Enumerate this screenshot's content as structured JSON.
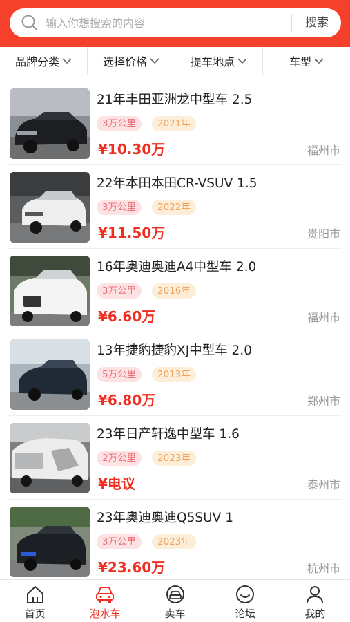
{
  "search": {
    "placeholder": "输入你想搜索的内容",
    "button": "搜索"
  },
  "filters": [
    "品牌分类",
    "选择价格",
    "提车地点",
    "车型"
  ],
  "cars": [
    {
      "title": "21年丰田亚洲龙中型车 2.5",
      "mileage": "3万公里",
      "year": "2021年",
      "price": "¥10.30万",
      "city": "福州市"
    },
    {
      "title": "22年本田本田CR-VSUV 1.5",
      "mileage": "3万公里",
      "year": "2022年",
      "price": "¥11.50万",
      "city": "贵阳市"
    },
    {
      "title": "16年奥迪奥迪A4中型车 2.0",
      "mileage": "3万公里",
      "year": "2016年",
      "price": "¥6.60万",
      "city": "福州市"
    },
    {
      "title": "13年捷豹捷豹XJ中型车 2.0",
      "mileage": "5万公里",
      "year": "2013年",
      "price": "¥6.80万",
      "city": "郑州市"
    },
    {
      "title": "23年日产轩逸中型车 1.6",
      "mileage": "2万公里",
      "year": "2023年",
      "price": "¥电议",
      "city": "泰州市"
    },
    {
      "title": "23年奥迪奥迪Q5SUV 1",
      "mileage": "3万公里",
      "year": "2023年",
      "price": "¥23.60万",
      "city": "杭州市"
    }
  ],
  "tabs": [
    {
      "label": "首页",
      "icon": "home-icon",
      "active": false
    },
    {
      "label": "泡水车",
      "icon": "car-icon",
      "active": true
    },
    {
      "label": "卖车",
      "icon": "sell-car-icon",
      "active": false
    },
    {
      "label": "论坛",
      "icon": "smile-icon",
      "active": false
    },
    {
      "label": "我的",
      "icon": "user-icon",
      "active": false
    }
  ],
  "colors": {
    "brand": "#f5412c",
    "price": "#ef2f22",
    "mileage_tag": "#f07079",
    "year_tag": "#f0a25a"
  }
}
